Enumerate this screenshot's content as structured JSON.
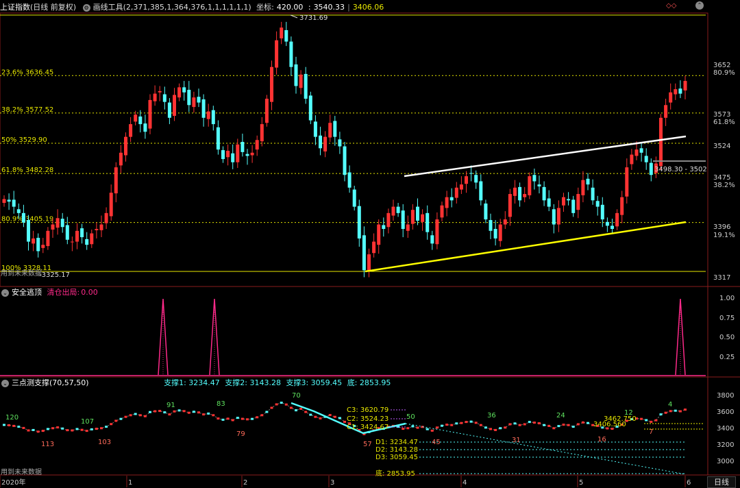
{
  "header": {
    "index_name": "上证指数",
    "mode": "(日线 前复权)",
    "tool": "画线工具",
    "tool_params": "(2,371,385,1,364,376,1,1,1,1,1,1)",
    "coord_label": "坐标:",
    "coord_value": "420.00",
    "price_a": "3540.33",
    "price_b": "3406.06"
  },
  "main_panel": {
    "price_high_label": "3731.69",
    "price_low_label": "3325.17",
    "future_data_label": "用到未来数据",
    "fib_levels": [
      {
        "label": "23.6% 3636.45",
        "price": 3636.45
      },
      {
        "label": "38.2% 3577.52",
        "price": 3577.52
      },
      {
        "label": "50% 3529.90",
        "price": 3529.9
      },
      {
        "label": "61.8% 3482.28",
        "price": 3482.28
      },
      {
        "label": "80.9% 3405.19",
        "price": 3405.19
      },
      {
        "label": "100% 3328.11",
        "price": 3328.11
      }
    ],
    "box_label": "3498.30 - 3502",
    "y_axis": [
      "3652",
      "3573",
      "3524",
      "3475",
      "3396",
      "3317"
    ],
    "y_pct": [
      "80.9%",
      "61.8%",
      "38.2%",
      "19.1%"
    ]
  },
  "panel2": {
    "title": "安全逃顶",
    "sub_label": "清仓出局:",
    "sub_value": "0.00",
    "y_axis": [
      "1.00",
      "0.75",
      "0.50",
      "0.25"
    ]
  },
  "panel3": {
    "title": "三点测支撑(70,57,50)",
    "s1": "支撑1: 3234.47",
    "s2": "支撑2: 3143.28",
    "s3": "支撑3: 3059.45",
    "bottom": "底: 2853.95",
    "y_axis": [
      "3800",
      "3600",
      "3400",
      "3200",
      "3000"
    ],
    "numbers_top": [
      "120",
      "107",
      "91",
      "83",
      "70",
      "50",
      "36",
      "24",
      "12",
      "4"
    ],
    "numbers_bottom": [
      "113",
      "103",
      "79",
      "57",
      "45",
      "31",
      "16",
      "7"
    ],
    "c_labels": [
      "C3: 3620.79",
      "C2: 3524.23",
      "C1: 3424.67"
    ],
    "d_labels": [
      "D1: 3234.47",
      "D2: 3143.28",
      "D3: 3059.45",
      "底: 2853.95"
    ],
    "right_labels": [
      "3462.750",
      "3406.560"
    ],
    "future_data_label": "用到未来数据"
  },
  "x_axis": {
    "labels": [
      "2020年",
      "1",
      "2",
      "3",
      "4",
      "5",
      "6"
    ],
    "period_button": "日线"
  },
  "colors": {
    "up": "#ff3333",
    "down": "#54ffff",
    "fib": "#e8e800",
    "upper_trend": "#ffffff",
    "lower_trend": "#ffff00",
    "signal": "#ff2a8a"
  }
}
